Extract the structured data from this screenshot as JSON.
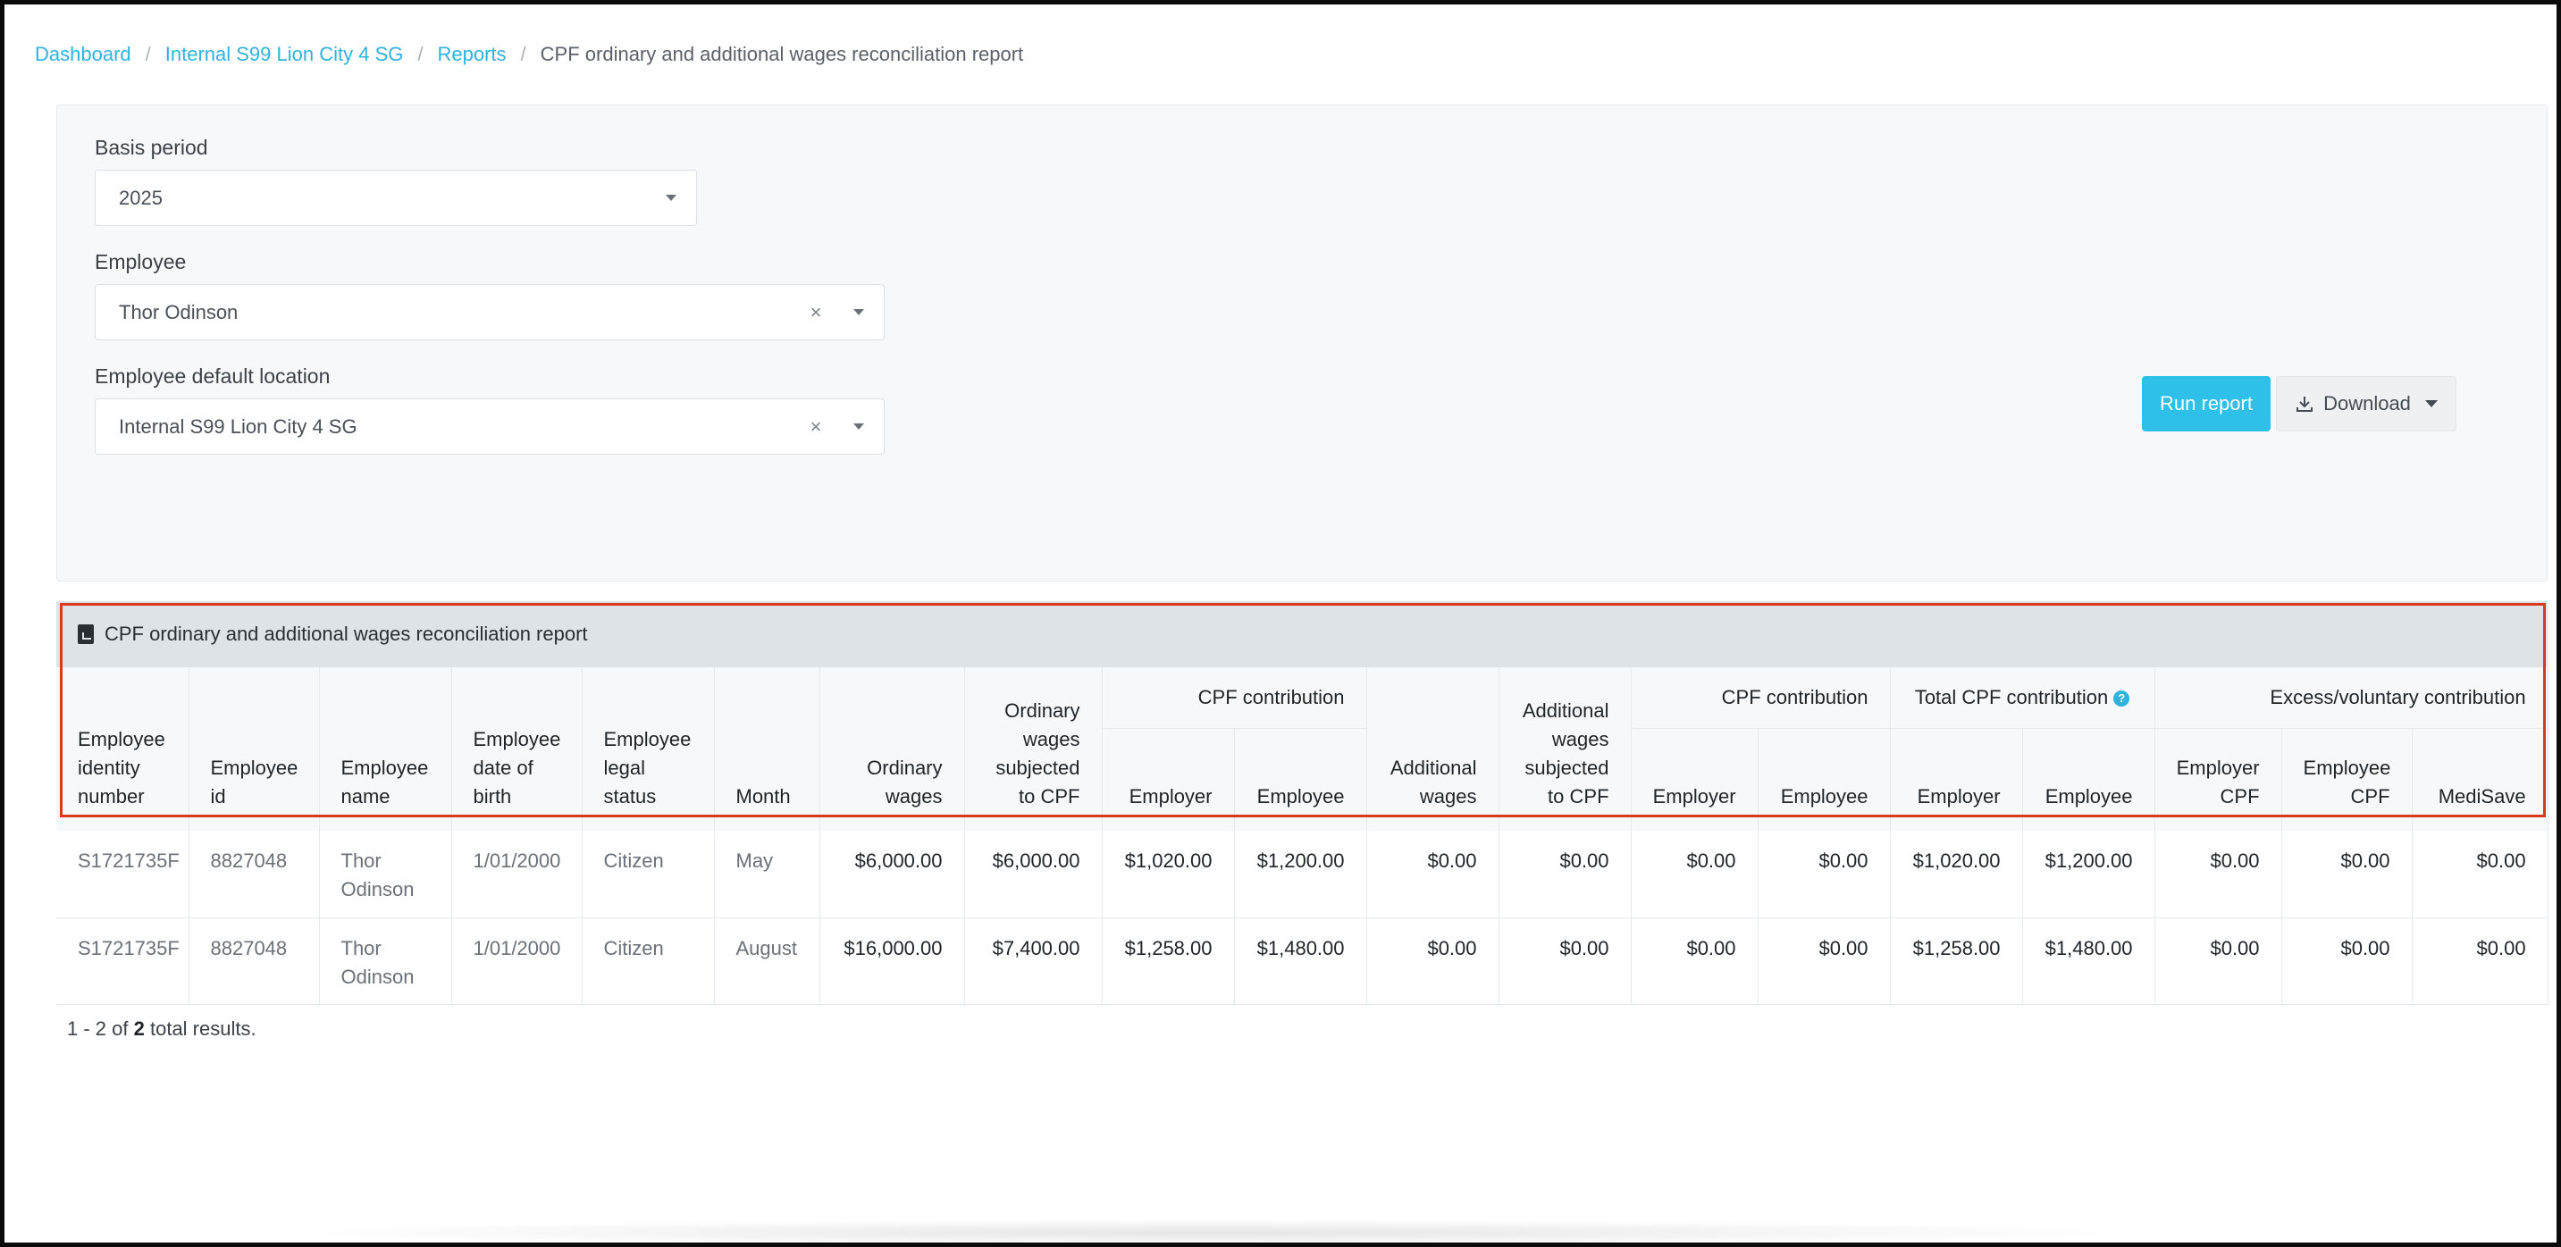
{
  "breadcrumb": {
    "items": [
      "Dashboard",
      "Internal S99 Lion City 4 SG",
      "Reports"
    ],
    "current": "CPF ordinary and additional wages reconciliation report",
    "separator": "/"
  },
  "filters": {
    "basis_period": {
      "label": "Basis period",
      "value": "2025"
    },
    "employee": {
      "label": "Employee",
      "value": "Thor Odinson"
    },
    "location": {
      "label": "Employee default location",
      "value": "Internal S99 Lion City 4 SG"
    },
    "clear_glyph": "×"
  },
  "actions": {
    "run_label": "Run report",
    "download_label": "Download"
  },
  "report": {
    "title": "CPF ordinary and additional wages reconciliation report",
    "groups": {
      "cpf_contribution_1": "CPF contribution",
      "cpf_contribution_2": "CPF contribution",
      "total_cpf": "Total CPF contribution",
      "excess": "Excess/voluntary contribution",
      "help": "?"
    },
    "columns": {
      "identity": [
        "Employee",
        "identity",
        "number"
      ],
      "id": [
        "Employee",
        "id"
      ],
      "name": [
        "Employee",
        "name"
      ],
      "dob": [
        "Employee",
        "date of",
        "birth"
      ],
      "legal": [
        "Employee",
        "legal",
        "status"
      ],
      "month": "Month",
      "ordinary_wages": [
        "Ordinary",
        "wages"
      ],
      "ow_subject": [
        "Ordinary",
        "wages",
        "subjected",
        "to CPF"
      ],
      "employer": "Employer",
      "employee": "Employee",
      "additional_wages": [
        "Additional",
        "wages"
      ],
      "aw_subject": [
        "Additional",
        "wages",
        "subjected",
        "to CPF"
      ],
      "employer2": "Employer",
      "employee2": "Employee",
      "employer3": "Employer",
      "employee3": "Employee",
      "employer_cpf": [
        "Employer",
        "CPF"
      ],
      "employee_cpf": [
        "Employee",
        "CPF"
      ],
      "medisave": "MediSave"
    },
    "rows": [
      {
        "identity": "S1721735F",
        "id": "8827048",
        "name_1": "Thor",
        "name_2": "Odinson",
        "dob": "1/01/2000",
        "legal": "Citizen",
        "month": "May",
        "ordinary_wages": "$6,000.00",
        "ow_subject": "$6,000.00",
        "cpf_employer": "$1,020.00",
        "cpf_employee": "$1,200.00",
        "additional_wages": "$0.00",
        "aw_subject": "$0.00",
        "cpf2_employer": "$0.00",
        "cpf2_employee": "$0.00",
        "total_employer": "$1,020.00",
        "total_employee": "$1,200.00",
        "excess_employer": "$0.00",
        "excess_employee": "$0.00",
        "medisave": "$0.00"
      },
      {
        "identity": "S1721735F",
        "id": "8827048",
        "name_1": "Thor",
        "name_2": "Odinson",
        "dob": "1/01/2000",
        "legal": "Citizen",
        "month": "August",
        "ordinary_wages": "$16,000.00",
        "ow_subject": "$7,400.00",
        "cpf_employer": "$1,258.00",
        "cpf_employee": "$1,480.00",
        "additional_wages": "$0.00",
        "aw_subject": "$0.00",
        "cpf2_employer": "$0.00",
        "cpf2_employee": "$0.00",
        "total_employer": "$1,258.00",
        "total_employee": "$1,480.00",
        "excess_employer": "$0.00",
        "excess_employee": "$0.00",
        "medisave": "$0.00"
      }
    ]
  },
  "results": {
    "range": "1 - 2 of",
    "total": "2",
    "suffix": "total results."
  },
  "colors": {
    "accent": "#2fc0ea",
    "link": "#2fb3dd",
    "highlight": "#d9391c"
  }
}
